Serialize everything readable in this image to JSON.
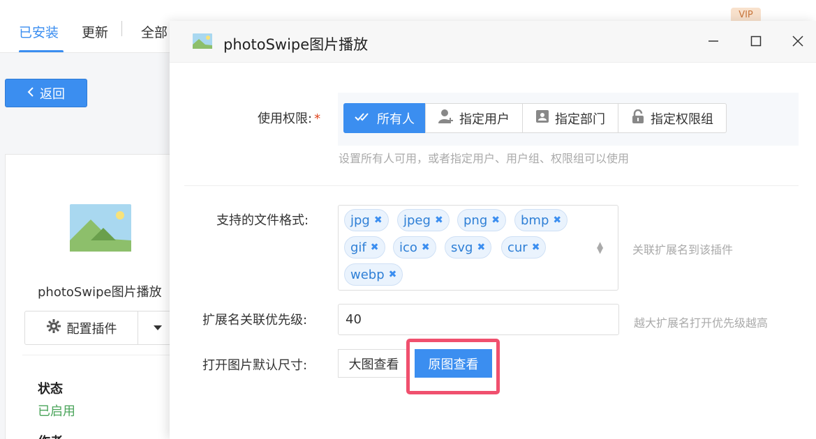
{
  "background": {
    "tabs": [
      {
        "label": "已安装",
        "active": true
      },
      {
        "label": "更新",
        "active": false
      },
      {
        "label": "全部",
        "active": false
      }
    ],
    "vip_badge": "VIP",
    "back_button": "返回",
    "plugin_card": {
      "name": "photoSwipe图片播放",
      "config_button": "配置插件",
      "status_label": "状态",
      "status_value": "已启用",
      "author_label": "作者"
    }
  },
  "dialog": {
    "title": "photoSwipe图片播放",
    "permission": {
      "label": "使用权限:",
      "required_mark": "*",
      "options": [
        {
          "label": "所有人",
          "icon": "double-check-icon",
          "active": true
        },
        {
          "label": "指定用户",
          "icon": "user-add-icon",
          "active": false
        },
        {
          "label": "指定部门",
          "icon": "department-icon",
          "active": false
        },
        {
          "label": "指定权限组",
          "icon": "lock-icon",
          "active": false
        }
      ],
      "hint": "设置所有人可用，或者指定用户、用户组、权限组可以使用"
    },
    "formats": {
      "label": "支持的文件格式:",
      "tags": [
        "jpg",
        "jpeg",
        "png",
        "bmp",
        "gif",
        "ico",
        "svg",
        "cur",
        "webp"
      ],
      "hint": "关联扩展名到该插件"
    },
    "priority": {
      "label": "扩展名关联优先级:",
      "value": "40",
      "hint": "越大扩展名打开优先级越高"
    },
    "default_size": {
      "label": "打开图片默认尺寸:",
      "options": [
        {
          "label": "大图查看",
          "active": false
        },
        {
          "label": "原图查看",
          "active": true
        }
      ]
    }
  },
  "colors": {
    "accent": "#3b8ef0",
    "highlight": "#f0506e",
    "status_enabled": "#4aa45a"
  }
}
